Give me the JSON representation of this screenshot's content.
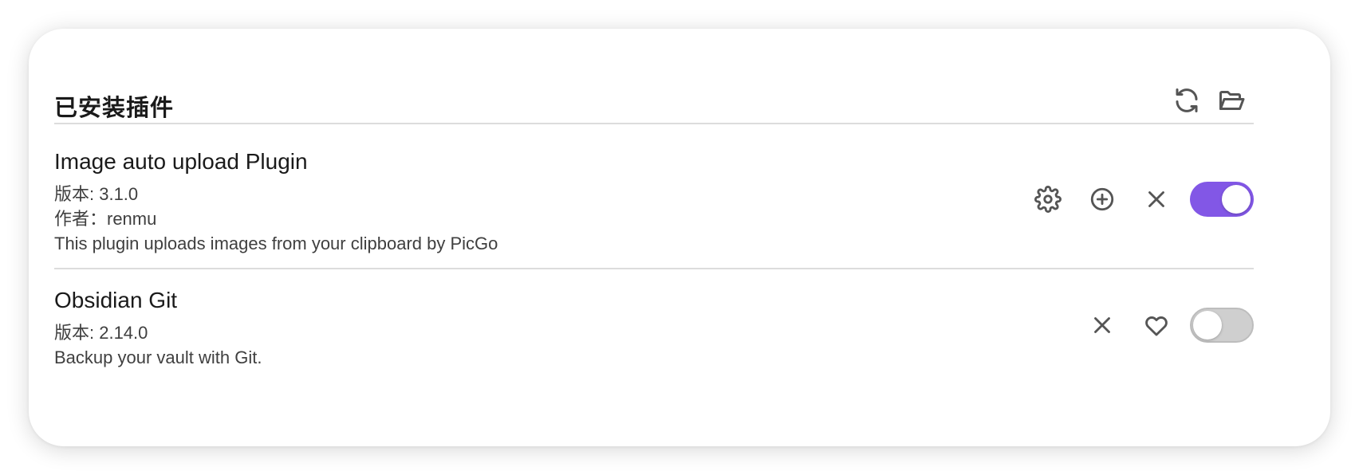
{
  "section": {
    "title": "已安装插件",
    "actions": [
      {
        "icon": "refresh-icon"
      },
      {
        "icon": "folder-open-icon"
      }
    ]
  },
  "plugins": [
    {
      "name": "Image auto upload Plugin",
      "version": "版本: 3.1.0",
      "author": "作者：renmu",
      "description": "This plugin uploads images from your clipboard by PicGo",
      "actions": [
        "gear-icon",
        "plus-circle-icon",
        "close-icon"
      ],
      "enabled": true
    },
    {
      "name": "Obsidian Git",
      "version": "版本: 2.14.0",
      "description": "Backup your vault with Git.",
      "actions": [
        "close-icon",
        "heart-icon"
      ],
      "enabled": false
    }
  ],
  "colors": {
    "toggle_on": "#8257e6",
    "toggle_off": "#cfcfcf",
    "divider": "#dcdcdc"
  }
}
